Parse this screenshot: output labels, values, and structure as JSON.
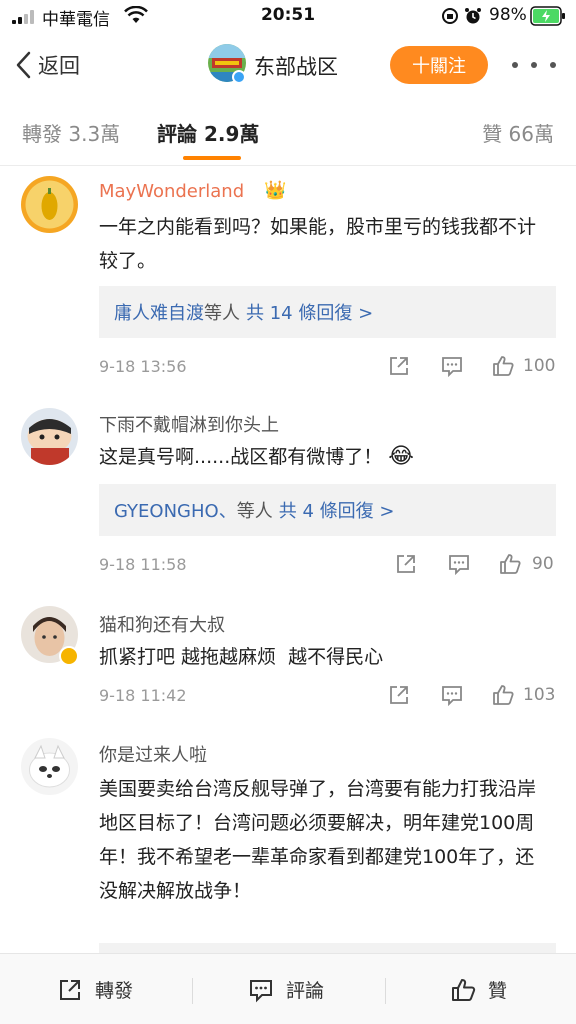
{
  "status_bar": {
    "carrier": "中華電信",
    "time": "20:51",
    "battery": "98%"
  },
  "nav": {
    "back_label": "返回",
    "title": "东部战区",
    "follow_label": "十關注"
  },
  "tabs": {
    "repost": "轉發 3.3萬",
    "comment": "評論 2.9萬",
    "like": "贊 66萬"
  },
  "comments": [
    {
      "name": "MayWonderland",
      "text": "一年之内能看到吗？如果能，股市里亏的钱我都不计较了。",
      "replies": {
        "names": "庸人难自渡",
        "suffix": "等人",
        "count": "共 14 條回復 >"
      },
      "time": "9-18 13:56",
      "likes": "100"
    },
    {
      "name": "下雨不戴帽淋到你头上",
      "text": "这是真号啊......战区都有微博了！",
      "replies": {
        "names": "GYEONGHO、",
        "suffix": "等人",
        "count": "共 4 條回復 >"
      },
      "time": "9-18 11:58",
      "likes": "90"
    },
    {
      "name": "猫和狗还有大叔",
      "text": "抓紧打吧 越拖越麻烦  越不得民心",
      "time": "9-18 11:42",
      "likes": "103"
    },
    {
      "name": "你是过来人啦",
      "text": "美国要卖给台湾反舰导弹了，台湾要有能力打我沿岸地区目标了！台湾问题必须要解决，明年建党100周年！我不希望老一辈革命家看到都建党100年了，还没解决解放战争！"
    }
  ],
  "bottom_bar": {
    "repost": "轉發",
    "comment": "評論",
    "like": "贊"
  },
  "colors": {
    "accent_orange": "#ff8200",
    "follow_button": "#ff8a1f",
    "vip_name": "#eb7350",
    "link_blue": "#3b6ab1"
  },
  "icons": [
    "back-chevron-icon",
    "wifi-icon",
    "signal-icon",
    "alarm-icon",
    "lock-rotation-icon",
    "battery-icon",
    "share-icon",
    "comment-icon",
    "thumbs-up-icon",
    "more-icon",
    "verified-badge-icon",
    "crown-emoji-icon",
    "laughing-emoji-icon"
  ]
}
